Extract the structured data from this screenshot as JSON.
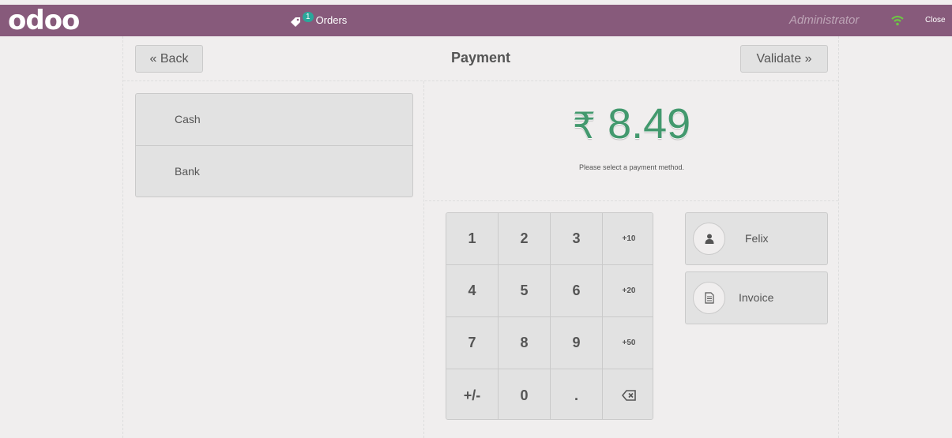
{
  "header": {
    "logo": "odoo",
    "orders_count": "1",
    "orders_label": "Orders",
    "user": "Administrator",
    "close_label": "Close"
  },
  "payment": {
    "back_label": "« Back",
    "title": "Payment",
    "validate_label": "Validate »",
    "methods": [
      {
        "label": "Cash"
      },
      {
        "label": "Bank"
      }
    ],
    "currency": "₹",
    "total": "8.49",
    "message": "Please select a payment method."
  },
  "numpad": {
    "keys": [
      "1",
      "2",
      "3",
      "+10",
      "4",
      "5",
      "6",
      "+20",
      "7",
      "8",
      "9",
      "+50",
      "+/-",
      "0",
      ".",
      ""
    ]
  },
  "customer": {
    "label": "Felix"
  },
  "invoice": {
    "label": "Invoice"
  },
  "colors": {
    "topbar": "#875a7b",
    "total": "#43996e",
    "badge": "#2aa79b",
    "wifi": "#6ec445"
  }
}
